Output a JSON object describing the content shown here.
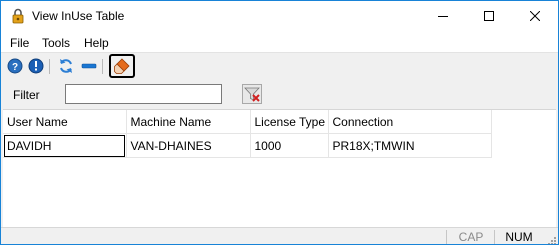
{
  "window": {
    "title": "View InUse Table"
  },
  "menu": {
    "file": "File",
    "tools": "Tools",
    "help": "Help"
  },
  "toolbar": {
    "buttons": [
      {
        "name": "help-icon",
        "color": "#2a6fbf"
      },
      {
        "name": "info-icon",
        "color": "#1b5fb5"
      },
      {
        "name": "refresh-icon",
        "color": "#2c7ed4"
      },
      {
        "name": "minus-icon",
        "color": "#1976d2"
      },
      {
        "name": "eraser-icon",
        "color": "#e46a1b"
      }
    ]
  },
  "filter": {
    "label": "Filter",
    "value": ""
  },
  "table": {
    "columns": [
      "User Name",
      "Machine Name",
      "License Type",
      "Connection"
    ],
    "rows": [
      [
        "DAVIDH",
        "VAN-DHAINES",
        "1000",
        "PR18X;TMWIN"
      ]
    ]
  },
  "status": {
    "cap": "CAP",
    "num": "NUM"
  }
}
